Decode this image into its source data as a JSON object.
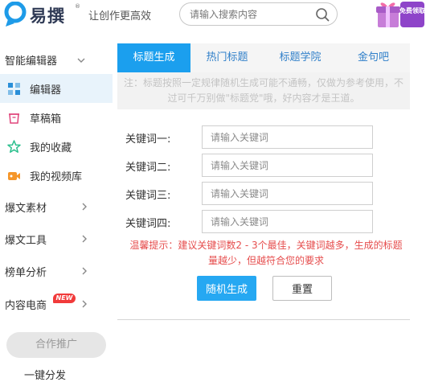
{
  "header": {
    "logo_text": "易撰",
    "logo_reg": "®",
    "slogan": "让创作更高效",
    "search_placeholder": "请输入搜索内容",
    "promo_text": "免费领取"
  },
  "sidebar": {
    "group_editor": "智能编辑器",
    "items": [
      {
        "label": "编辑器",
        "icon": "editor-icon"
      },
      {
        "label": "草稿箱",
        "icon": "draft-box-icon"
      },
      {
        "label": "我的收藏",
        "icon": "star-icon"
      },
      {
        "label": "我的视频库",
        "icon": "video-icon"
      }
    ],
    "groups": [
      "爆文素材",
      "爆文工具",
      "榜单分析",
      "内容电商"
    ],
    "new_badge": "NEW",
    "coop_button": "合作推广",
    "one_click": "一键分发"
  },
  "main": {
    "tabs": [
      "标题生成",
      "热门标题",
      "标题学院",
      "金句吧"
    ],
    "active_tab": 0,
    "notice": "注：标题按照一定规律随机生成可能不通畅，仅做为参考使用，不过可千万别做\"标题党\"哦，好内容才是王道。",
    "fields": [
      {
        "label": "关键词一:",
        "placeholder": "请输入关键词",
        "value": ""
      },
      {
        "label": "关键词二:",
        "placeholder": "请输入关键词",
        "value": ""
      },
      {
        "label": "关键词三:",
        "placeholder": "请输入关键词",
        "value": ""
      },
      {
        "label": "关键词四:",
        "placeholder": "请输入关键词",
        "value": ""
      }
    ],
    "tip": "温馨提示：建议关键词数2 - 3个最佳，关键词越多，生成的标题量越少，但越符合您的要求",
    "generate_button": "随机生成",
    "reset_button": "重置"
  },
  "colors": {
    "accent": "#1b9fee",
    "tab_text": "#2f7fc9",
    "tip": "#e64d4d",
    "active_row": "#e8f3fb"
  }
}
